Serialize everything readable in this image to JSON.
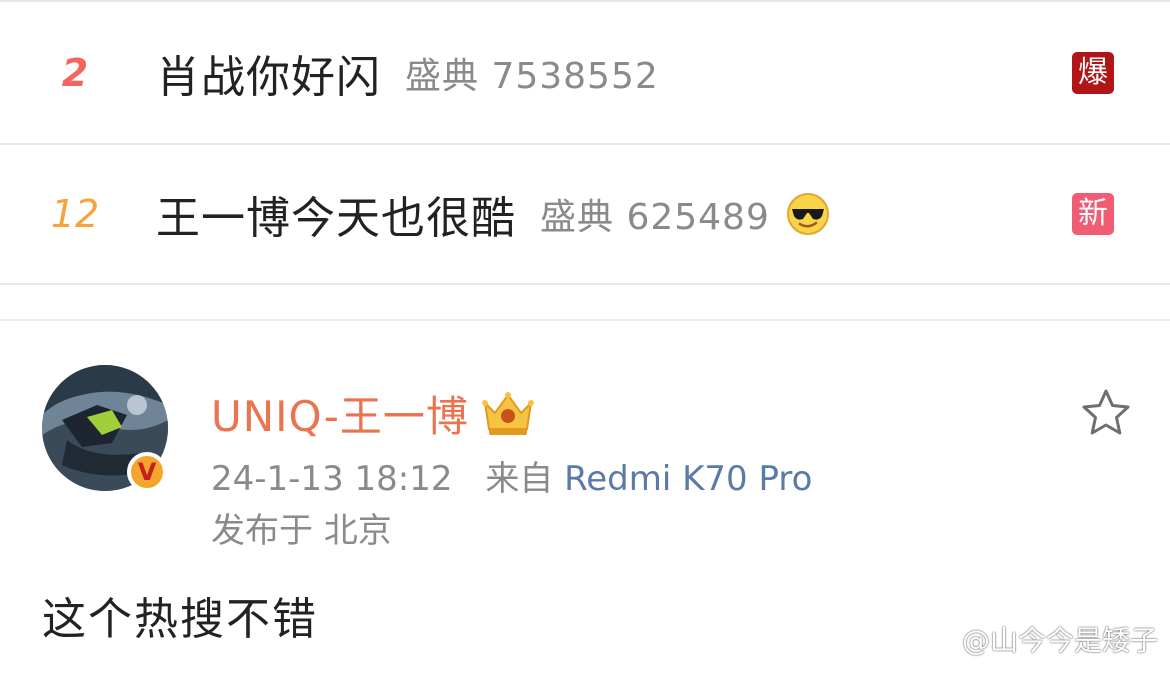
{
  "hot_search": {
    "items": [
      {
        "rank": "2",
        "title": "肖战你好闪",
        "meta": "盛典 7538552",
        "badge": "爆",
        "badge_color": "#b11518",
        "emoji": ""
      },
      {
        "rank": "12",
        "title": "王一博今天也很酷",
        "meta": "盛典 625489",
        "badge": "新",
        "badge_color": "#f25b74",
        "emoji": "sunglasses-smiley-icon"
      }
    ]
  },
  "post": {
    "username": "UNIQ-王一博",
    "verified_icon": "v-verified-icon",
    "member_icon": "crown-member-icon",
    "timestamp": "24-1-13 18:12",
    "from_label": "来自",
    "device": "Redmi K70 Pro",
    "location": "发布于 北京",
    "text": "这个热搜不错",
    "favorite_icon": "star-outline-icon"
  },
  "watermark": {
    "icon": "weibo-logo-icon",
    "text": "@山今今是矮子"
  },
  "colors": {
    "username": "#eb7350",
    "device_link": "#5b7aa7",
    "rank_top": "#f36560",
    "rank_mid": "#f7a23a"
  }
}
